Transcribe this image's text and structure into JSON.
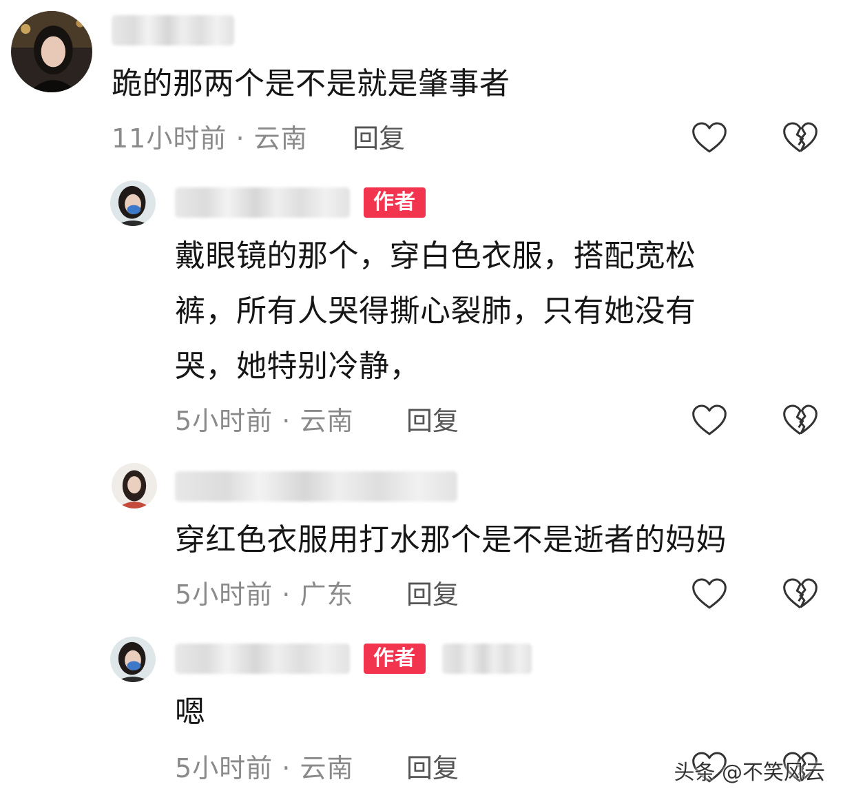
{
  "comments": [
    {
      "text": "跪的那两个是不是就是肇事者",
      "time": "11小时前",
      "location": "云南",
      "reply_label": "回复"
    },
    {
      "badge": "作者",
      "text_lines": [
        "戴眼镜的那个，穿白色衣服，搭配宽松",
        "裤，所有人哭得撕心裂肺，只有她没有",
        "哭，她特别冷静，"
      ],
      "time": "5小时前",
      "location": "云南",
      "reply_label": "回复"
    },
    {
      "text": "穿红色衣服用打水那个是不是逝者的妈妈",
      "time": "5小时前",
      "location": "广东",
      "reply_label": "回复"
    },
    {
      "badge": "作者",
      "text": "嗯",
      "time": "5小时前",
      "location": "云南",
      "reply_label": "回复"
    }
  ],
  "meta_separator": " · ",
  "icons": {
    "like": "heart-outline-icon",
    "dislike": "broken-heart-icon"
  },
  "colors": {
    "badge": "#f2344e",
    "meta": "#8a8a8a",
    "text": "#161616"
  },
  "watermark": "头条 @不笑风云"
}
